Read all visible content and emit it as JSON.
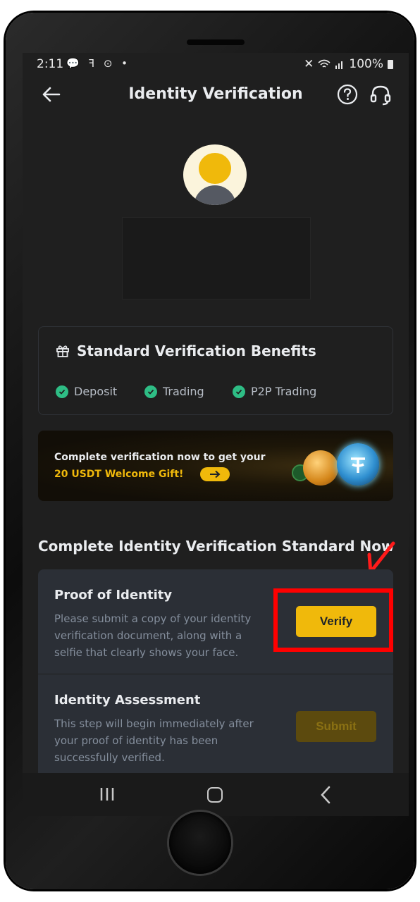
{
  "status_bar": {
    "time": "2:11",
    "left_icons": "💬 ꟻ ⊙ •",
    "signal": "📶",
    "battery_text": "100%"
  },
  "header": {
    "title": "Identity Verification"
  },
  "benefits": {
    "title": "Standard Verification Benefits",
    "items": [
      "Deposit",
      "Trading",
      "P2P Trading"
    ]
  },
  "banner": {
    "line1": "Complete verification now to get your",
    "line2": "20 USDT Welcome Gift!"
  },
  "section": {
    "heading": "Complete Identity Verification Standard Now"
  },
  "steps": [
    {
      "title": "Proof of Identity",
      "description": "Please submit a copy of your identity verification document, along with a selfie that clearly shows your face.",
      "button": "Verify"
    },
    {
      "title": "Identity Assessment",
      "description": "This step will begin immediately after your proof of identity has been successfully verified.",
      "button": "Submit"
    }
  ],
  "colors": {
    "accent": "#f0b90b",
    "success": "#2ebd85",
    "highlight": "#ff0000",
    "background": "#1f1f1f"
  }
}
